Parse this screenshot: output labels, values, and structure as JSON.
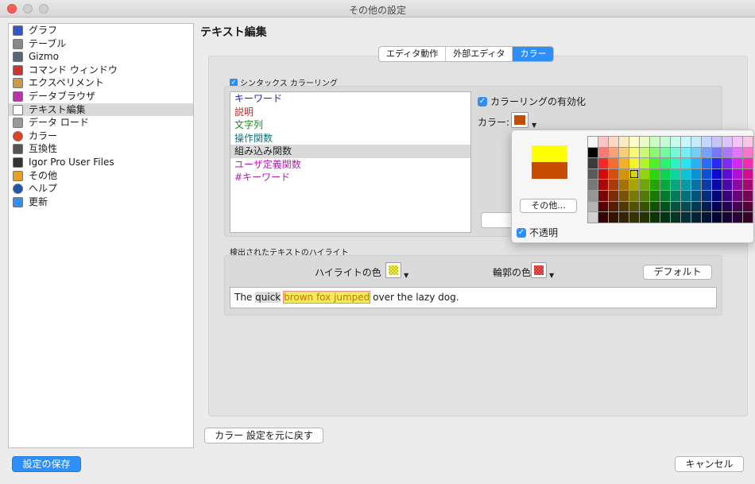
{
  "window": {
    "title": "その他の設定"
  },
  "sidebar": {
    "items": [
      {
        "label": "グラフ",
        "icon": "graph-icon",
        "color": "#3355cc"
      },
      {
        "label": "テーブル",
        "icon": "table-icon",
        "color": "#888888"
      },
      {
        "label": "Gizmo",
        "icon": "gizmo-icon",
        "color": "#556677"
      },
      {
        "label": "コマンド ウィンドウ",
        "icon": "command-window-icon",
        "color": "#cc3333"
      },
      {
        "label": "エクスペリメント",
        "icon": "experiment-icon",
        "color": "#cc9944"
      },
      {
        "label": "データブラウザ",
        "icon": "data-browser-icon",
        "color": "#bb33aa"
      },
      {
        "label": "テキスト編集",
        "icon": "text-edit-icon",
        "color": "#ffffff"
      },
      {
        "label": "データ ロード",
        "icon": "data-load-icon",
        "color": "#999999"
      },
      {
        "label": "カラー",
        "icon": "color-wheel-icon",
        "color": "#dd4422"
      },
      {
        "label": "互換性",
        "icon": "compatibility-icon",
        "color": "#555555"
      },
      {
        "label": "Igor Pro User Files",
        "icon": "folder-icon",
        "color": "#333333"
      },
      {
        "label": "その他",
        "icon": "misc-icon",
        "color": "#e8a020"
      },
      {
        "label": "ヘルプ",
        "icon": "help-icon",
        "color": "#2255aa"
      },
      {
        "label": "更新",
        "icon": "update-arrow-icon",
        "color": "#2d8ff7"
      }
    ],
    "selected_index": 6
  },
  "section": {
    "title": "テキスト編集"
  },
  "tabs": [
    {
      "label": "エディタ動作"
    },
    {
      "label": "外部エディタ"
    },
    {
      "label": "カラー"
    }
  ],
  "active_tab": 2,
  "syntax": {
    "label": "シンタックス カラーリング",
    "checked": true,
    "items": [
      {
        "label": "キーワード",
        "color": "#1a1acc"
      },
      {
        "label": "説明",
        "color": "#d62020"
      },
      {
        "label": "文字列",
        "color": "#1b8a1b"
      },
      {
        "label": "操作関数",
        "color": "#14707a"
      },
      {
        "label": "組み込み関数",
        "color": "#222222"
      },
      {
        "label": "ユーザ定義関数",
        "color": "#b21bb2"
      },
      {
        "label": "#キーワード",
        "color": "#b21bb2"
      }
    ],
    "selected_index": 4,
    "enable_label": "カラーリングの有効化",
    "color_label": "カラー:",
    "current_color": "#c44d00"
  },
  "popover": {
    "preview_old": "#ffff00",
    "preview_new": "#c44d00",
    "other_label": "その他...",
    "opaque_label": "不透明",
    "opaque_checked": true
  },
  "highlight": {
    "section_label": "検出されたテキストのハイライト",
    "highlight_color_label": "ハイライトの色",
    "highlight_color": "#f2ec3a",
    "outline_color_label": "輪郭の色",
    "outline_color": "#ee5555",
    "default_label": "デフォルト",
    "sample_before": "The ",
    "sample_quick": "quick",
    "sample_space": " ",
    "sample_highlighted": "brown fox jumped",
    "sample_after": " over the lazy dog."
  },
  "buttons": {
    "reset": "カラー 設定を元に戻す",
    "save": "設定の保存",
    "cancel": "キャンセル"
  }
}
